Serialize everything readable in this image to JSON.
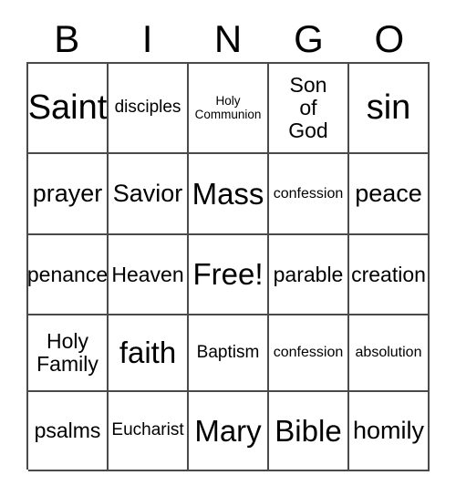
{
  "card": {
    "headers": [
      "B",
      "I",
      "N",
      "G",
      "O"
    ],
    "rows": [
      [
        {
          "text": "Saint",
          "size": "xxl"
        },
        {
          "text": "disciples",
          "size": "sm"
        },
        {
          "text": "Holy\nCommunion",
          "size": "xxs"
        },
        {
          "text": "Son\nof\nGod",
          "size": "md"
        },
        {
          "text": "sin",
          "size": "xxl"
        }
      ],
      [
        {
          "text": "prayer",
          "size": "lg"
        },
        {
          "text": "Savior",
          "size": "lg"
        },
        {
          "text": "Mass",
          "size": "xl"
        },
        {
          "text": "confession",
          "size": "xs"
        },
        {
          "text": "peace",
          "size": "lg"
        }
      ],
      [
        {
          "text": "penance",
          "size": "md"
        },
        {
          "text": "Heaven",
          "size": "md"
        },
        {
          "text": "Free!",
          "size": "xl"
        },
        {
          "text": "parable",
          "size": "md"
        },
        {
          "text": "creation",
          "size": "md"
        }
      ],
      [
        {
          "text": "Holy\nFamily",
          "size": "md"
        },
        {
          "text": "faith",
          "size": "xl"
        },
        {
          "text": "Baptism",
          "size": "sm"
        },
        {
          "text": "confession",
          "size": "xs"
        },
        {
          "text": "absolution",
          "size": "xs"
        }
      ],
      [
        {
          "text": "psalms",
          "size": "md"
        },
        {
          "text": "Eucharist",
          "size": "sm"
        },
        {
          "text": "Mary",
          "size": "xl"
        },
        {
          "text": "Bible",
          "size": "xl"
        },
        {
          "text": "homily",
          "size": "lg"
        }
      ]
    ]
  }
}
